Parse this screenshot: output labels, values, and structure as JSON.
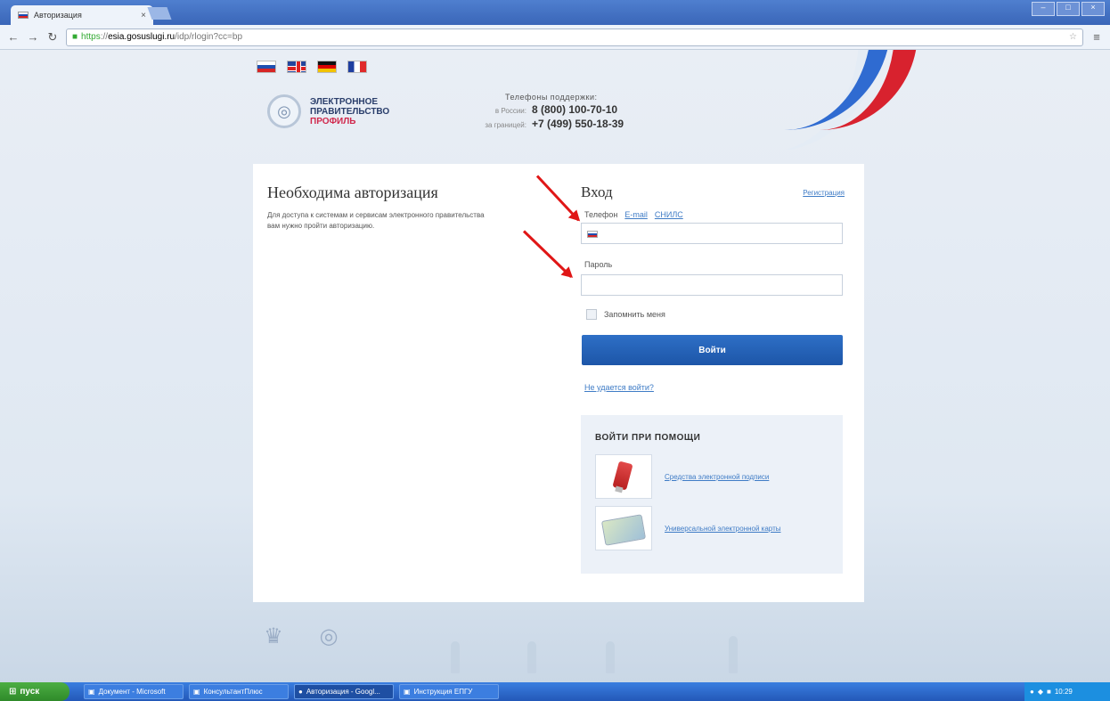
{
  "browser": {
    "tab_title": "Авторизация",
    "url_https": "https",
    "url_host": "esia.gosuslugi.ru",
    "url_path": "/idp/rlogin?cc=bp"
  },
  "header": {
    "logo_line1": "ЭЛЕКТРОННОЕ",
    "logo_line2": "ПРАВИТЕЛЬСТВО",
    "logo_line3": "ПРОФИЛЬ",
    "support_title": "Телефоны поддержки:",
    "phone1_label": "в России:",
    "phone1": "8 (800) 100-70-10",
    "phone2_label": "за границей:",
    "phone2": "+7 (499) 550-18-39"
  },
  "auth": {
    "need_title": "Необходима авторизация",
    "need_text": "Для доступа к системам и сервисам электронного правительства вам нужно пройти авторизацию.",
    "login_title": "Вход",
    "register_link": "Регистрация",
    "tab_phone": "Телефон",
    "tab_email": "E-mail",
    "tab_snils": "СНИЛС",
    "password_label": "Пароль",
    "remember_label": "Запомнить меня",
    "login_button": "Войти",
    "forgot_link": "Не удается войти?",
    "alt_title": "ВОЙТИ ПРИ ПОМОЩИ",
    "alt_signature": "Средства электронной подписи",
    "alt_card": "Универсальной электронной карты"
  },
  "taskbar": {
    "start": "пуск",
    "task1": "Документ - Microsoft",
    "task2": "КонсультантПлюс",
    "task3": "Авторизация - Googl...",
    "task4": "Инструкция ЕПГУ",
    "clock": "10:29"
  }
}
